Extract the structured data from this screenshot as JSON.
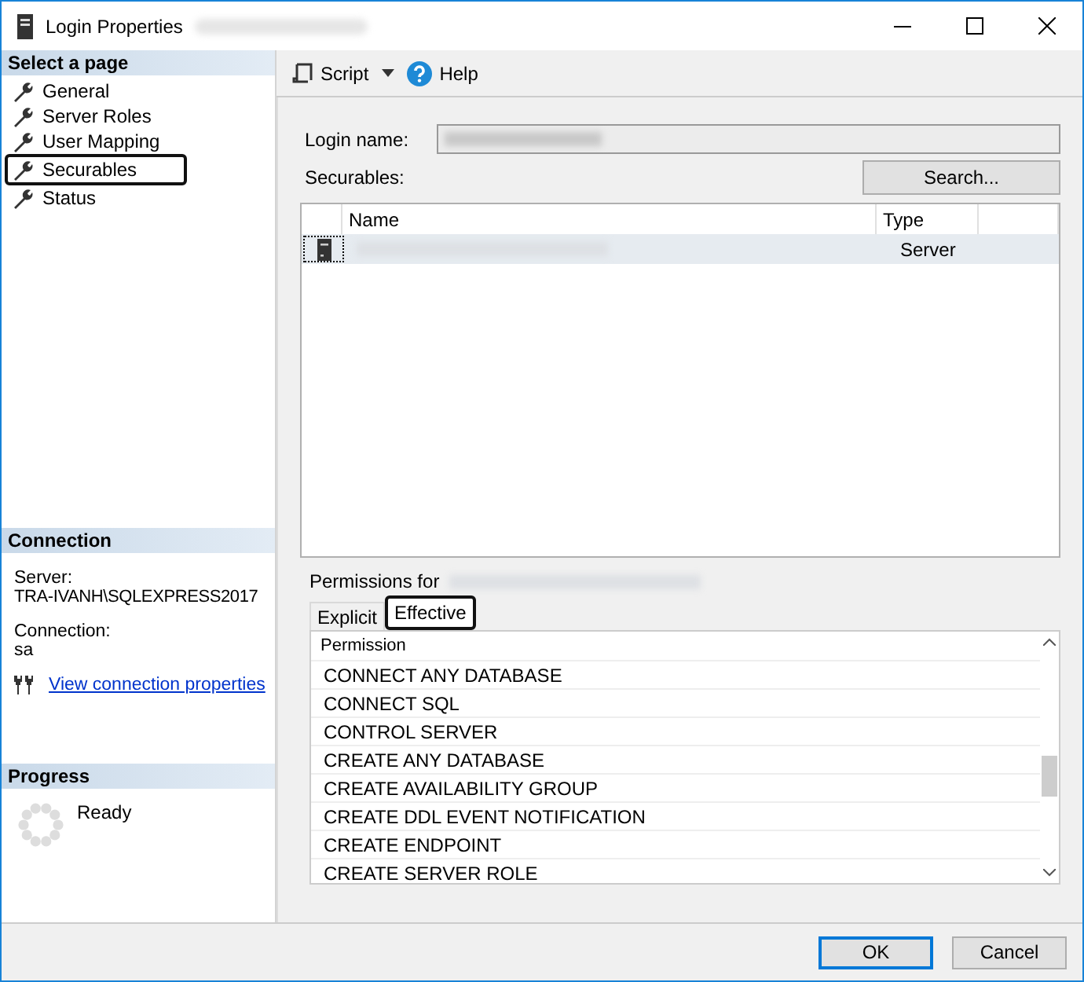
{
  "window": {
    "title": "Login Properties"
  },
  "sidebar": {
    "header": "Select a page",
    "items": [
      {
        "label": "General",
        "selected": false
      },
      {
        "label": "Server Roles",
        "selected": false
      },
      {
        "label": "User Mapping",
        "selected": false
      },
      {
        "label": "Securables",
        "selected": true
      },
      {
        "label": "Status",
        "selected": false
      }
    ]
  },
  "connection": {
    "header": "Connection",
    "server_label": "Server:",
    "server": "TRA-IVANH\\SQLEXPRESS2017",
    "connection_label": "Connection:",
    "connection": "sa",
    "link": "View connection properties"
  },
  "progress": {
    "header": "Progress",
    "status": "Ready"
  },
  "toolbar": {
    "script": "Script",
    "help": "Help"
  },
  "login_name_label": "Login name:",
  "securables_label": "Securables:",
  "search_button": "Search...",
  "securables_table": {
    "columns": [
      "Name",
      "Type"
    ],
    "rows": [
      {
        "type": "Server",
        "selected": true
      }
    ]
  },
  "permissions_for_label": "Permissions for",
  "tabs": [
    {
      "label": "Explicit",
      "selected": false
    },
    {
      "label": "Effective",
      "selected": true
    }
  ],
  "permissions": {
    "column": "Permission",
    "rows": [
      "CONNECT ANY DATABASE",
      "CONNECT SQL",
      "CONTROL SERVER",
      "CREATE ANY DATABASE",
      "CREATE AVAILABILITY GROUP",
      "CREATE DDL EVENT NOTIFICATION",
      "CREATE ENDPOINT",
      "CREATE SERVER ROLE"
    ]
  },
  "buttons": [
    "OK",
    "Cancel"
  ]
}
